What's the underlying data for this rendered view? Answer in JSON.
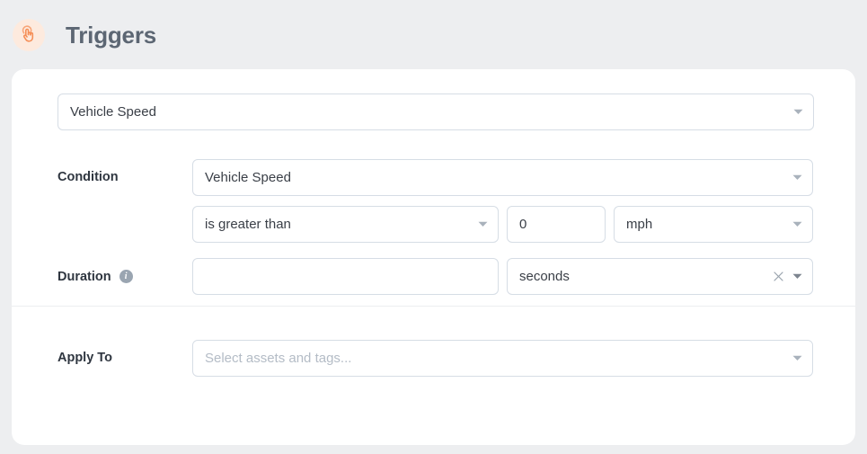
{
  "header": {
    "title": "Triggers",
    "icon": "tap-gesture-icon",
    "icon_color": "#f58d55",
    "icon_background": "#fdeade",
    "background": "#edeef0",
    "title_color": "#5c6673"
  },
  "card": {
    "background": "#ffffff",
    "border_color": "#d6dde5"
  },
  "trigger_type": {
    "value": "Vehicle Speed",
    "caret": "chevron-down-icon"
  },
  "condition": {
    "label": "Condition",
    "metric": {
      "value": "Vehicle Speed",
      "caret": "chevron-down-icon"
    },
    "operator": {
      "value": "is greater than",
      "caret": "chevron-down-icon"
    },
    "threshold": {
      "value": "0"
    },
    "unit": {
      "value": "mph",
      "caret": "chevron-down-icon"
    }
  },
  "duration": {
    "label": "Duration",
    "info_icon": "info-icon",
    "amount": {
      "value": "",
      "placeholder": ""
    },
    "time_unit": {
      "value": "seconds",
      "clear_icon": "close-icon",
      "caret": "chevron-down-icon"
    }
  },
  "apply_to": {
    "label": "Apply To",
    "selector": {
      "value": "",
      "placeholder": "Select assets and tags...",
      "caret": "chevron-down-icon"
    }
  }
}
